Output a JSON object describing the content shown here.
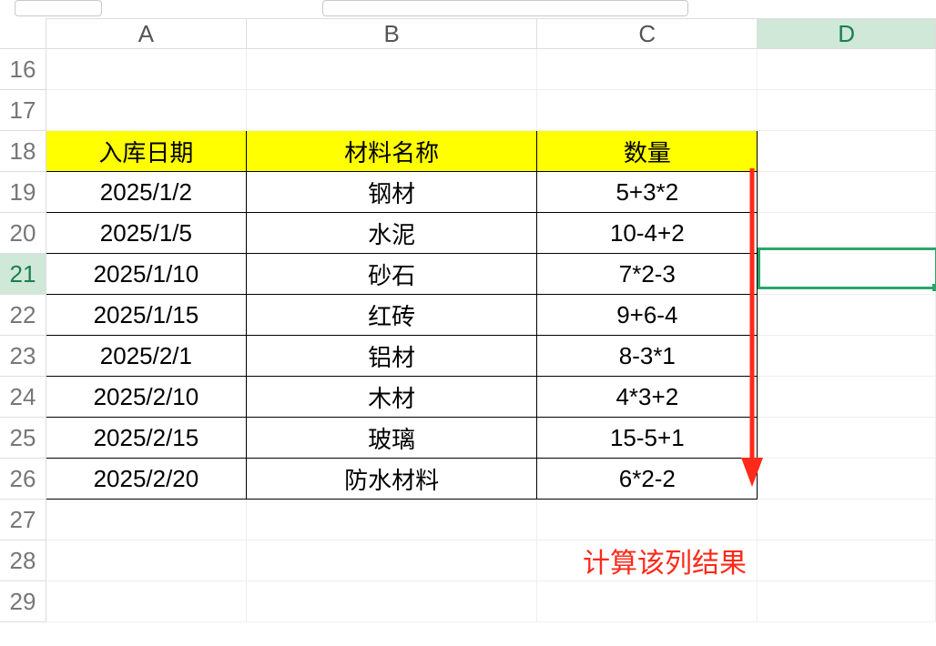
{
  "columns": {
    "A": "A",
    "B": "B",
    "C": "C",
    "D": "D"
  },
  "rows": [
    "16",
    "17",
    "18",
    "19",
    "20",
    "21",
    "22",
    "23",
    "24",
    "25",
    "26",
    "27",
    "28",
    "29"
  ],
  "active_row": "21",
  "active_col": "D",
  "header": {
    "A": "入库日期",
    "B": "材料名称",
    "C": "数量"
  },
  "data": [
    {
      "A": "2025/1/2",
      "B": "钢材",
      "C": "5+3*2"
    },
    {
      "A": "2025/1/5",
      "B": "水泥",
      "C": "10-4+2"
    },
    {
      "A": "2025/1/10",
      "B": "砂石",
      "C": "7*2-3"
    },
    {
      "A": "2025/1/15",
      "B": "红砖",
      "C": "9+6-4"
    },
    {
      "A": "2025/2/1",
      "B": "铝材",
      "C": "8-3*1"
    },
    {
      "A": "2025/2/10",
      "B": "木材",
      "C": "4*3+2"
    },
    {
      "A": "2025/2/15",
      "B": "玻璃",
      "C": "15-5+1"
    },
    {
      "A": "2025/2/20",
      "B": "防水材料",
      "C": "6*2-2"
    }
  ],
  "annotation": "计算该列结果"
}
